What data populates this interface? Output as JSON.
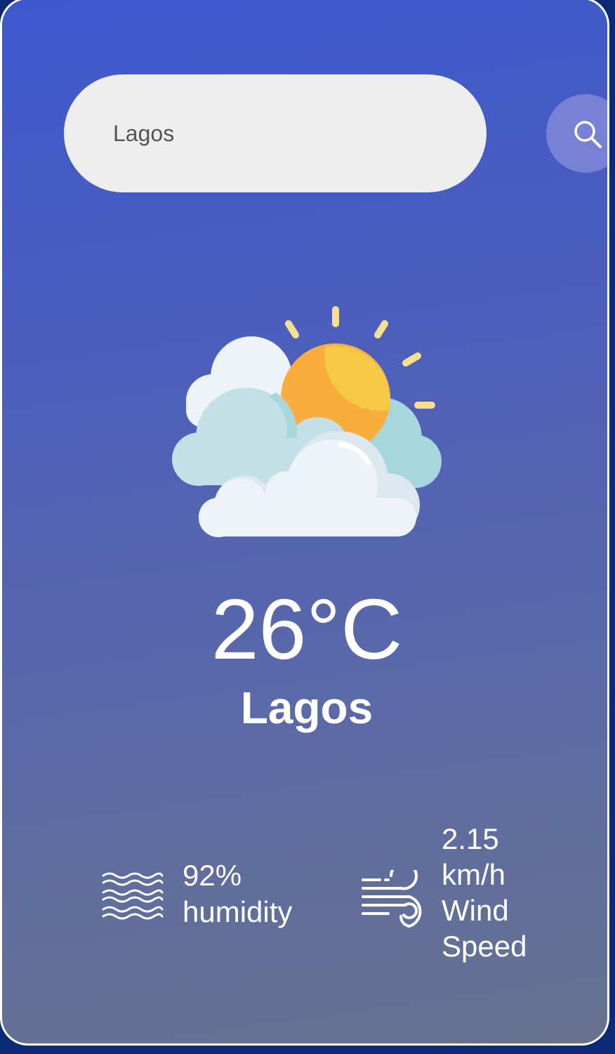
{
  "search": {
    "value": "Lagos",
    "placeholder": ""
  },
  "weather": {
    "icon": "partly-cloudy-sun-icon",
    "temperature": "26°C",
    "city": "Lagos"
  },
  "humidity": {
    "icon": "waves-icon",
    "value": "92%",
    "label": "humidity"
  },
  "wind": {
    "icon": "wind-icon",
    "value": "2.15",
    "unit": "km/h",
    "label_line1": "Wind",
    "label_line2": "Speed"
  },
  "colors": {
    "card_top": "#3d58cf",
    "card_bottom": "#67738f",
    "search_bg": "#eeeeee",
    "search_button": "#7781d6",
    "sun": "#f6c945",
    "sun_shade": "#f9ad3d",
    "cloud": "#eef3f7",
    "cloud_shade": "#a6d6de"
  }
}
